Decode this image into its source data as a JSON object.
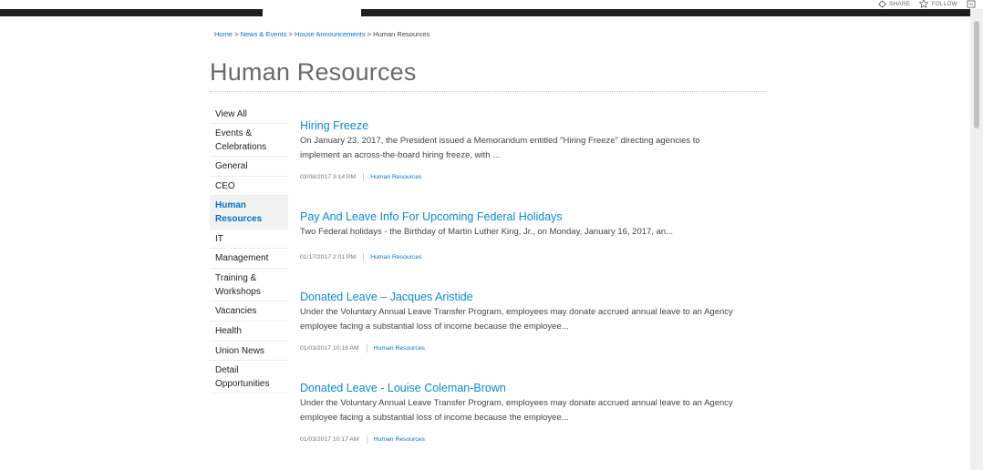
{
  "suite_bar": {
    "share_label": "SHARE",
    "follow_label": "FOLLOW"
  },
  "breadcrumb": {
    "items": [
      "Home",
      "News & Events",
      "House Announcements"
    ],
    "current": "Human Resources",
    "separator": ">"
  },
  "page_title": "Human Resources",
  "left_nav": {
    "items": [
      "View All",
      "Events & Celebrations",
      "General",
      "CEO",
      "Human Resources",
      "IT",
      "Management",
      "Training & Workshops",
      "Vacancies",
      "Health",
      "Union News",
      "Detail Opportunities"
    ],
    "active": "Human Resources"
  },
  "posts": [
    {
      "title": "Hiring Freeze",
      "excerpt": "On January 23, 2017, the President issued a Memorandum entitled \"Hiring Freeze\" directing agencies to implement an across-the-board hiring freeze, with ...",
      "date": "03/08/2017 3:14 PM",
      "category": "Human Resources"
    },
    {
      "title": "Pay And Leave Info For Upcoming Federal Holidays",
      "excerpt": "Two Federal holidays - the Birthday of Martin Luther King, Jr., on Monday, January 16, 2017, an...",
      "date": "01/17/2017 2:01 PM",
      "category": "Human Resources"
    },
    {
      "title": "Donated Leave – Jacques Aristide",
      "excerpt": "Under the Voluntary Annual Leave Transfer Program, employees may donate accrued annual leave to an Agency employee facing a substantial loss of income because the employee...",
      "date": "01/03/2017 10:18 AM",
      "category": "Human Resources"
    },
    {
      "title": "Donated Leave - Louise Coleman-Brown",
      "excerpt": "Under the Voluntary Annual Leave Transfer Program, employees may donate accrued annual leave to an Agency employee facing a substantial loss of income because the employee...",
      "date": "01/03/2017 10:17 AM",
      "category": "Human Resources"
    }
  ],
  "colors": {
    "link": "#0072c6",
    "post_title": "#0a8ad4",
    "dark_bar": "#1e1e1e",
    "title_text": "#6a6a6a"
  }
}
